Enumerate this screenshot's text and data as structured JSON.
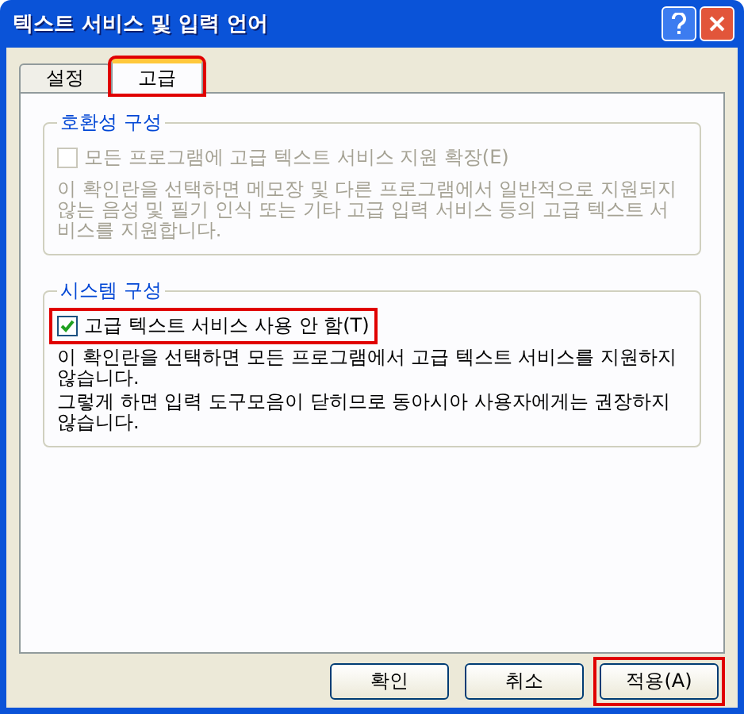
{
  "window": {
    "title": "텍스트 서비스 및 입력 언어"
  },
  "tabs": [
    {
      "label": "설정",
      "selected": false,
      "highlighted": false
    },
    {
      "label": "고급",
      "selected": true,
      "highlighted": true
    }
  ],
  "groups": [
    {
      "title": "호환성 구성",
      "disabled": true,
      "checkbox": {
        "label": "모든 프로그램에 고급 텍스트 서비스 지원 확장(E)",
        "checked": false,
        "highlighted": false
      },
      "description": [
        "이 확인란을 선택하면 메모장 및 다른 프로그램에서 일반적으로 지원되지 않는 음성 및 필기 인식 또는 기타 고급 입력 서비스 등의 고급 텍스트 서비스를 지원합니다."
      ]
    },
    {
      "title": "시스템 구성",
      "disabled": false,
      "checkbox": {
        "label": "고급 텍스트 서비스 사용 안 함(T)",
        "checked": true,
        "highlighted": true
      },
      "description": [
        "이 확인란을 선택하면 모든 프로그램에서 고급 텍스트 서비스를 지원하지 않습니다.",
        "그렇게 하면 입력 도구모음이 닫히므로 동아시아 사용자에게는 권장하지 않습니다."
      ]
    }
  ],
  "buttons": [
    {
      "label": "확인",
      "highlighted": false
    },
    {
      "label": "취소",
      "highlighted": false
    },
    {
      "label": "적용(A)",
      "highlighted": true
    }
  ]
}
